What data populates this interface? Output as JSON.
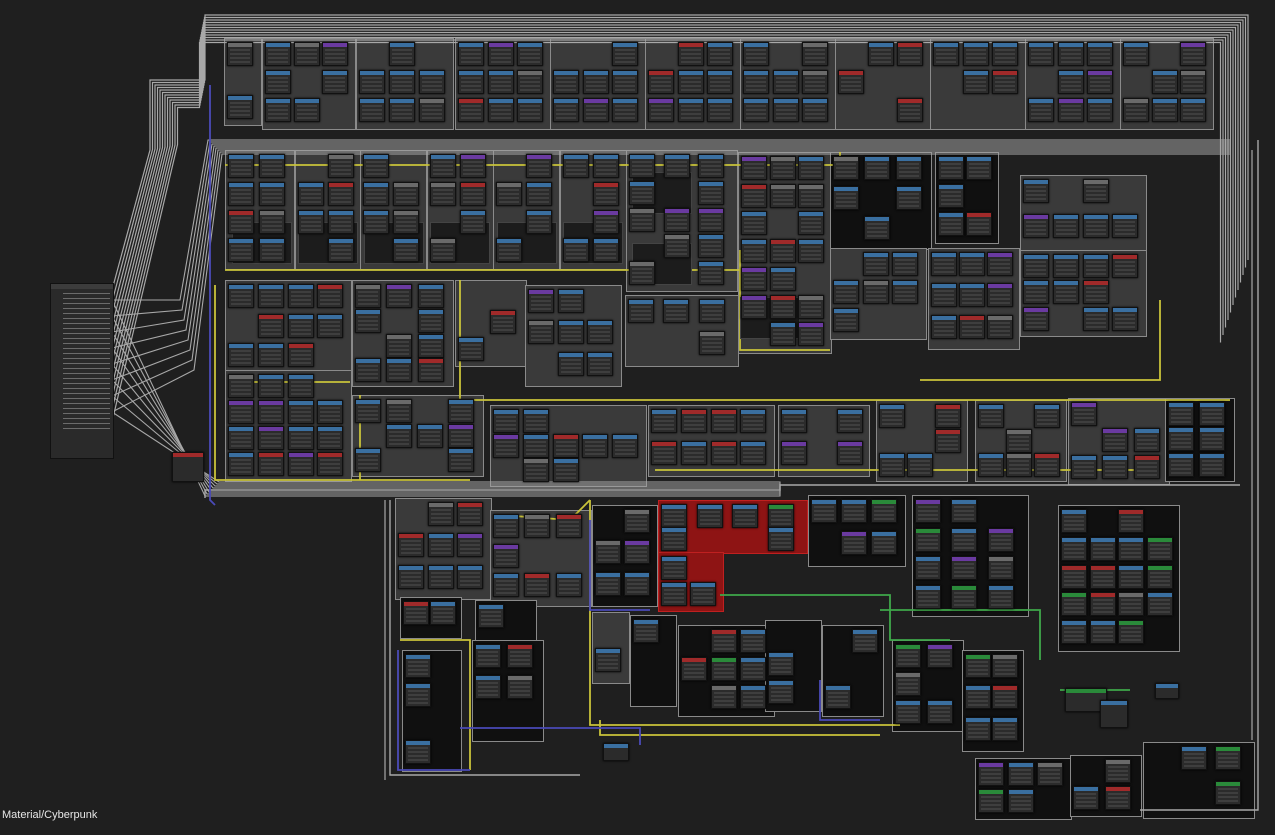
{
  "editor": {
    "breadcrumb": "Material/Cyberpunk",
    "colors": {
      "background": "#1f1f1f",
      "wire_grey": "#a8a8a8",
      "wire_yellow": "#c9c33a",
      "wire_blue": "#4a4ab8",
      "wire_green": "#3fa84a",
      "node_blue": "#3a6fa0",
      "node_purple": "#6a3aa0",
      "node_red": "#a02a2a",
      "frame_red": "#8e1414"
    }
  }
}
